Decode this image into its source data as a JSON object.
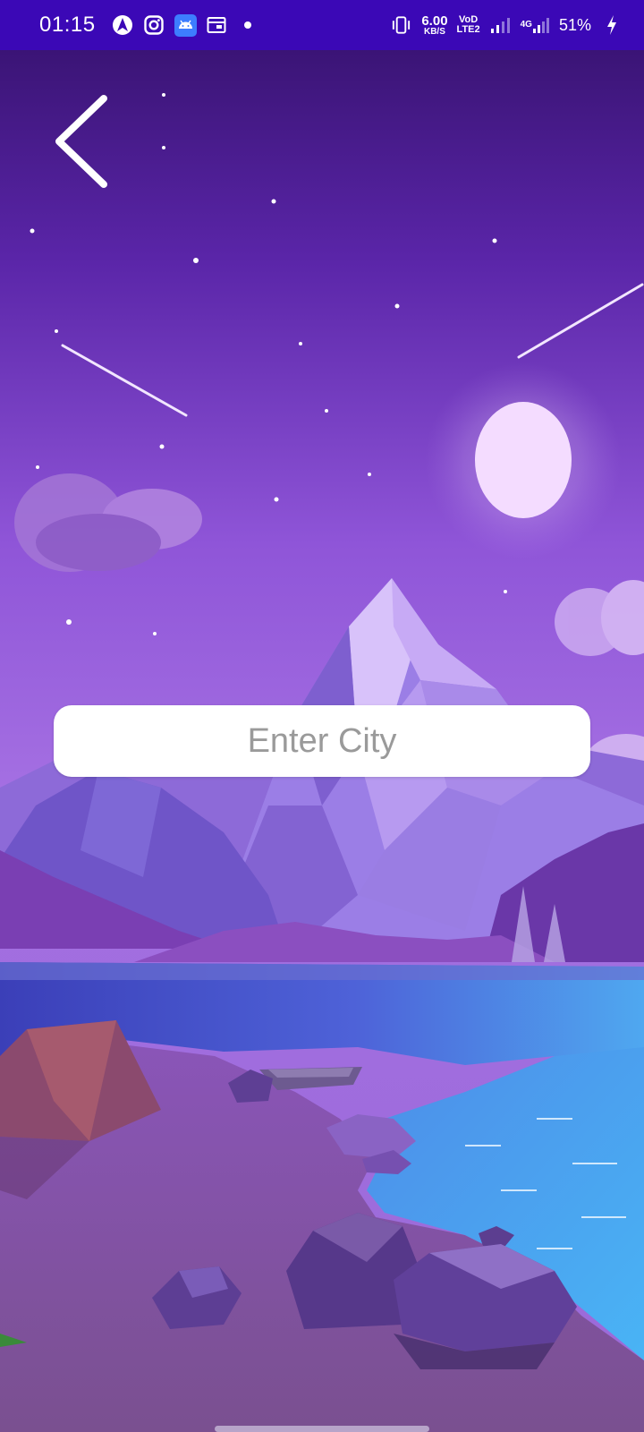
{
  "status_bar": {
    "time": "01:15",
    "left_icons": [
      "navigation-arrow-icon",
      "instagram-icon",
      "android-icon",
      "calendar-icon",
      "dot-icon"
    ],
    "net_speed_value": "6.00",
    "net_speed_unit": "KB/S",
    "volte_top": "VoD",
    "volte_bottom": "LTE2",
    "signal_label": "4G",
    "battery_percent": "51%"
  },
  "back_button": {
    "icon": "chevron-left-icon"
  },
  "city_search": {
    "placeholder": "Enter City",
    "value": ""
  },
  "background": {
    "description_icon": "night-mountain-lake-scene",
    "colors": {
      "sky_top": "#3a1270",
      "sky_mid": "#8a4fd6",
      "sky_bottom": "#a873e6",
      "moon": "#f5ddff",
      "lake": "#4a6ee0",
      "shore": "#7a4a9e",
      "status_bar": "#3b08b6"
    }
  }
}
